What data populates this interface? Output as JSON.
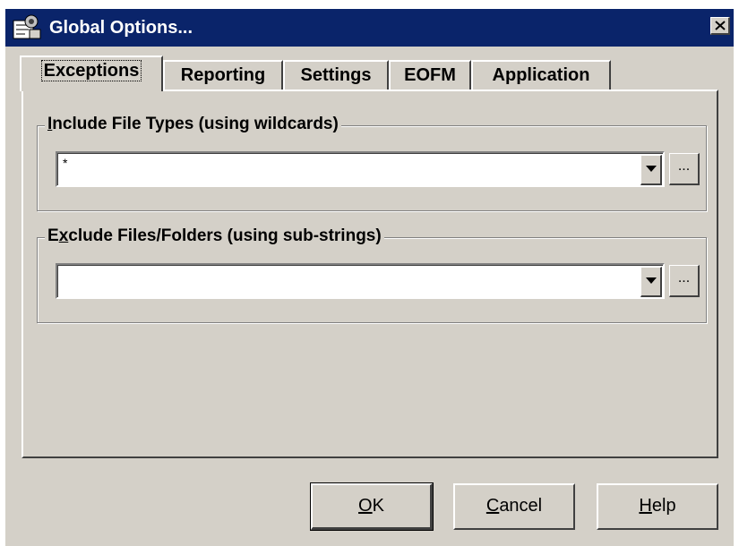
{
  "window": {
    "title": "Global Options...",
    "icon": "app-window-icon",
    "close_icon": "close-icon"
  },
  "tabs": [
    {
      "label": "Exceptions",
      "active": true
    },
    {
      "label": "Reporting",
      "active": false
    },
    {
      "label": "Settings",
      "active": false
    },
    {
      "label": "EOFM",
      "active": false
    },
    {
      "label": "Application",
      "active": false
    }
  ],
  "include_group": {
    "label_accel": "I",
    "label_rest": "nclude File Types (using wildcards)",
    "value": "*",
    "browse_label": "..."
  },
  "exclude_group": {
    "label_pre": "E",
    "label_accel": "x",
    "label_rest": "clude Files/Folders (using sub-strings)",
    "value": "",
    "browse_label": "..."
  },
  "buttons": {
    "ok": {
      "accel": "O",
      "rest": "K"
    },
    "cancel": {
      "accel": "C",
      "rest": "ancel"
    },
    "help": {
      "accel": "H",
      "rest": "elp"
    }
  },
  "colors": {
    "titlebar": "#0a246a",
    "face": "#d4d0c8"
  }
}
